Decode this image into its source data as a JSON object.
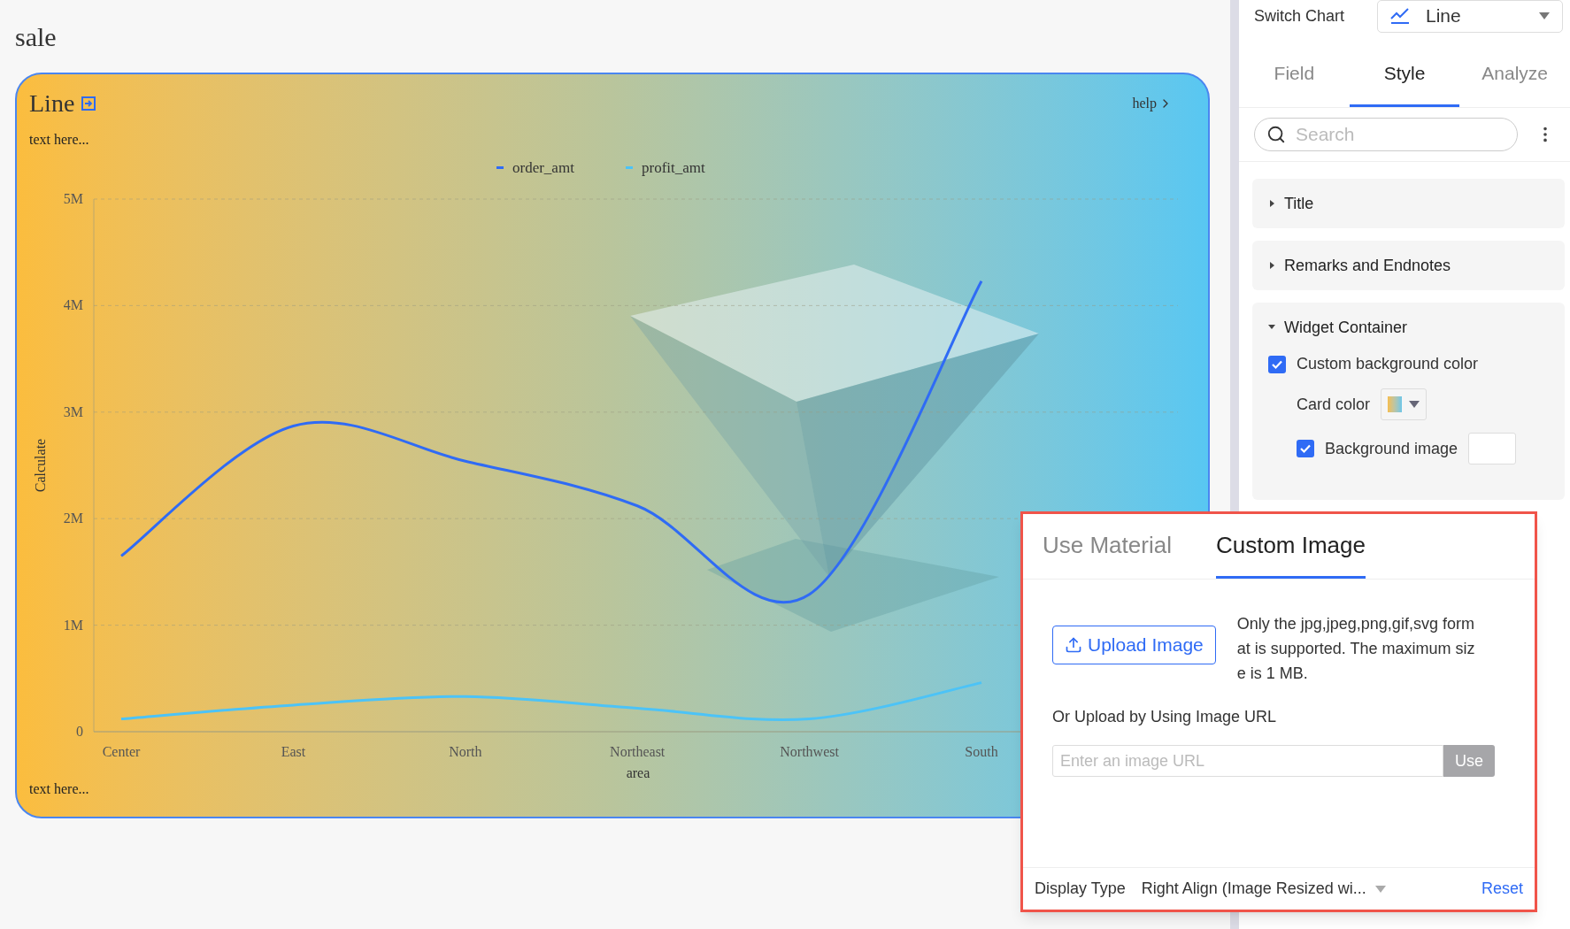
{
  "page_title": "sale",
  "card": {
    "title": "Line",
    "help": "help",
    "subtitle": "text here...",
    "footnote": "text here...",
    "chart_data": {
      "type": "line",
      "xlabel": "area",
      "ylabel": "Calculate",
      "categories": [
        "Center",
        "East",
        "North",
        "Northeast",
        "Northwest",
        "South"
      ],
      "series": [
        {
          "name": "order_amt",
          "color": "#2f6bf5",
          "values": [
            1650000,
            2870000,
            2540000,
            2120000,
            1290000,
            4230000
          ]
        },
        {
          "name": "profit_amt",
          "color": "#4cc3f7",
          "values": [
            120000,
            250000,
            330000,
            220000,
            120000,
            460000
          ]
        }
      ],
      "ylim": [
        0,
        5000000
      ],
      "grid": true,
      "legend": true,
      "yticks": [
        {
          "value": 0,
          "label": "0"
        },
        {
          "value": 1000000,
          "label": "1M"
        },
        {
          "value": 2000000,
          "label": "2M"
        },
        {
          "value": 3000000,
          "label": "3M"
        },
        {
          "value": 4000000,
          "label": "4M"
        },
        {
          "value": 5000000,
          "label": "5M"
        }
      ]
    }
  },
  "panel": {
    "switch_label": "Switch Chart",
    "chart_type": "Line",
    "tabs": [
      {
        "label": "Field",
        "selected": false
      },
      {
        "label": "Style",
        "selected": true
      },
      {
        "label": "Analyze",
        "selected": false
      }
    ],
    "search": {
      "placeholder": "Search"
    },
    "sections": [
      {
        "label": "Title",
        "expanded": false
      },
      {
        "label": "Remarks and Endnotes",
        "expanded": false
      },
      {
        "label": "Widget Container",
        "expanded": true
      }
    ],
    "custom_bg": {
      "label": "Custom background color",
      "checked": true
    },
    "card_color_label": "Card color",
    "bg_image": {
      "label": "Background image",
      "checked": true
    }
  },
  "popup": {
    "tabs": [
      {
        "label": "Use Material",
        "selected": false
      },
      {
        "label": "Custom Image",
        "selected": true
      }
    ],
    "upload_button": "Upload Image",
    "hint": "Only the jpg,jpeg,png,gif,svg format is supported. The maximum size is 1 MB.",
    "url_label": "Or Upload by Using Image URL",
    "url_field": {
      "placeholder": "Enter an image URL"
    },
    "use_button": {
      "label": "Use",
      "disabled": true
    },
    "display_type_label": "Display Type",
    "display_type_value": "Right Align (Image Resized wi...",
    "reset": "Reset"
  }
}
